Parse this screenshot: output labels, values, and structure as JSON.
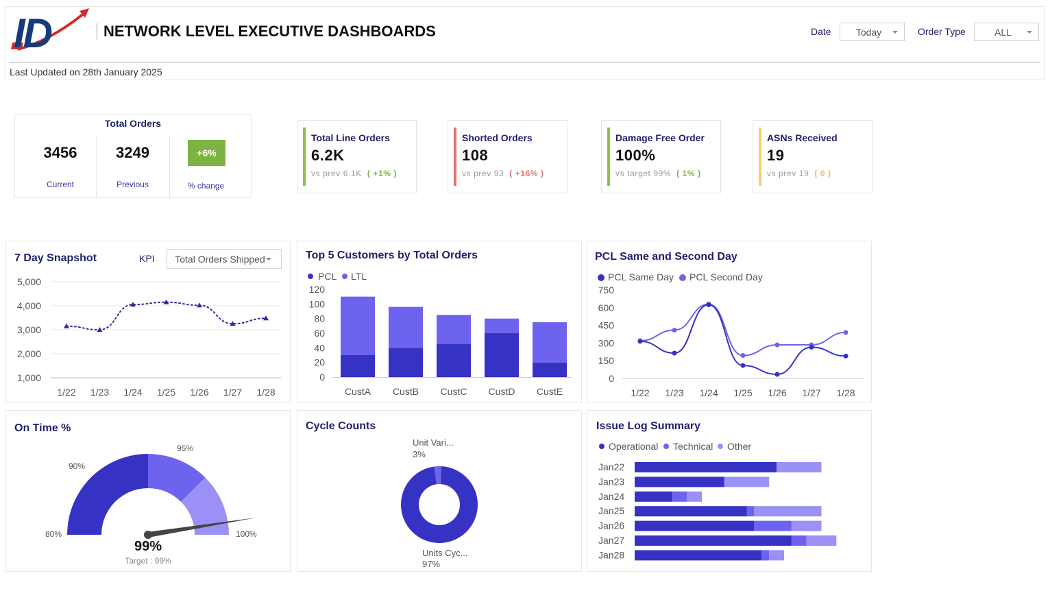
{
  "header": {
    "logo_text": "ID",
    "title": "NETWORK LEVEL EXECUTIVE DASHBOARDS",
    "last_updated": "Last Updated on 28th January 2025",
    "date_label": "Date",
    "date_value": "Today",
    "order_type_label": "Order Type",
    "order_type_value": "ALL"
  },
  "total_orders": {
    "title": "Total Orders",
    "current_value": "3456",
    "current_label": "Current",
    "previous_value": "3249",
    "previous_label": "Previous",
    "change_value": "+6%",
    "change_label": "% change",
    "change_color": "#7cb342"
  },
  "kpis": [
    {
      "title": "Total Line Orders",
      "value": "6.2K",
      "sub": "vs prev 6.1K",
      "delta": "( +1% )",
      "color": "#8bc34a",
      "delta_color": "#7cb342"
    },
    {
      "title": "Shorted Orders",
      "value": "108",
      "sub": "vs prev 93",
      "delta": "( +16% )",
      "color": "#e57373",
      "delta_color": "#e57373"
    },
    {
      "title": "Damage Free Order",
      "value": "100%",
      "sub": "vs target 99%",
      "delta": "( 1% )",
      "color": "#8bc34a",
      "delta_color": "#7cb342"
    },
    {
      "title": "ASNs Received",
      "value": "19",
      "sub": "vs prev 19",
      "delta": "( 0 )",
      "color": "#ffca66",
      "delta_color": "#f5b94e"
    }
  ],
  "snapshot": {
    "title": "7 Day Snapshot",
    "kpi_label": "KPI",
    "kpi_value": "Total Orders Shipped"
  },
  "top_customers": {
    "title": "Top 5 Customers by Total Orders",
    "legend": [
      "PCL",
      "LTL"
    ]
  },
  "pcl": {
    "title": "PCL Same and Second Day",
    "legend": [
      "PCL Same Day",
      "PCL Second Day"
    ]
  },
  "ontime": {
    "title": "On Time %",
    "value": "99%",
    "target": "Target : 99%",
    "labels": [
      "80%",
      "90%",
      "95%",
      "100%"
    ]
  },
  "cycle": {
    "title": "Cycle Counts",
    "label_a": "Unit Vari...",
    "pct_a": "3%",
    "label_b": "Units Cyc...",
    "pct_b": "97%"
  },
  "issue": {
    "title": "Issue Log Summary",
    "legend": [
      "Operational",
      "Technical",
      "Other"
    ]
  },
  "colors": {
    "primary": "#3632c4",
    "secondary": "#6e63ee",
    "tertiary": "#9a90f5",
    "title_navy": "#1f1f6e"
  },
  "chart_data": [
    {
      "type": "line",
      "title": "7 Day Snapshot",
      "x": [
        "1/22",
        "1/23",
        "1/24",
        "1/25",
        "1/26",
        "1/27",
        "1/28"
      ],
      "series": [
        {
          "name": "Total Orders Shipped",
          "values": [
            3150,
            3000,
            4050,
            4150,
            4020,
            3250,
            3480
          ]
        }
      ],
      "y_ticks": [
        "1,000",
        "2,000",
        "3,000",
        "4,000",
        "5,000"
      ],
      "ylim": [
        1000,
        5000
      ]
    },
    {
      "type": "bar",
      "title": "Top 5 Customers by Total Orders",
      "categories": [
        "CustA",
        "CustB",
        "CustC",
        "CustD",
        "CustE"
      ],
      "series": [
        {
          "name": "PCL",
          "values": [
            30,
            40,
            45,
            60,
            20
          ]
        },
        {
          "name": "LTL",
          "values": [
            80,
            56,
            40,
            20,
            55
          ]
        }
      ],
      "y_ticks": [
        "0",
        "20",
        "40",
        "60",
        "80",
        "100",
        "120"
      ],
      "ylim": [
        0,
        120
      ],
      "stacked": true
    },
    {
      "type": "line",
      "title": "PCL Same and Second Day",
      "x": [
        "1/22",
        "1/23",
        "1/24",
        "1/25",
        "1/26",
        "1/27",
        "1/28"
      ],
      "series": [
        {
          "name": "PCL Same Day",
          "values": [
            315,
            215,
            625,
            110,
            35,
            265,
            190
          ]
        },
        {
          "name": "PCL Second Day",
          "values": [
            320,
            410,
            630,
            195,
            285,
            285,
            390
          ]
        }
      ],
      "y_ticks": [
        "0",
        "150",
        "300",
        "450",
        "600",
        "750"
      ],
      "ylim": [
        0,
        750
      ]
    },
    {
      "type": "pie",
      "title": "Cycle Counts",
      "labels": [
        "Unit Vari...",
        "Units Cyc..."
      ],
      "values": [
        3,
        97
      ]
    },
    {
      "type": "bar",
      "title": "Issue Log Summary",
      "orientation": "horizontal",
      "categories": [
        "Jan22",
        "Jan23",
        "Jan24",
        "Jan25",
        "Jan26",
        "Jan27",
        "Jan28"
      ],
      "series": [
        {
          "name": "Operational",
          "values": [
            19,
            12,
            5,
            15,
            16,
            21,
            17
          ]
        },
        {
          "name": "Technical",
          "values": [
            0,
            0,
            2,
            1,
            5,
            2,
            1
          ]
        },
        {
          "name": "Other",
          "values": [
            6,
            6,
            2,
            9,
            4,
            4,
            2
          ]
        }
      ],
      "stacked": true
    },
    {
      "type": "gauge",
      "title": "On Time %",
      "value": 99,
      "target": 99,
      "bands": [
        80,
        90,
        95,
        100
      ]
    }
  ]
}
